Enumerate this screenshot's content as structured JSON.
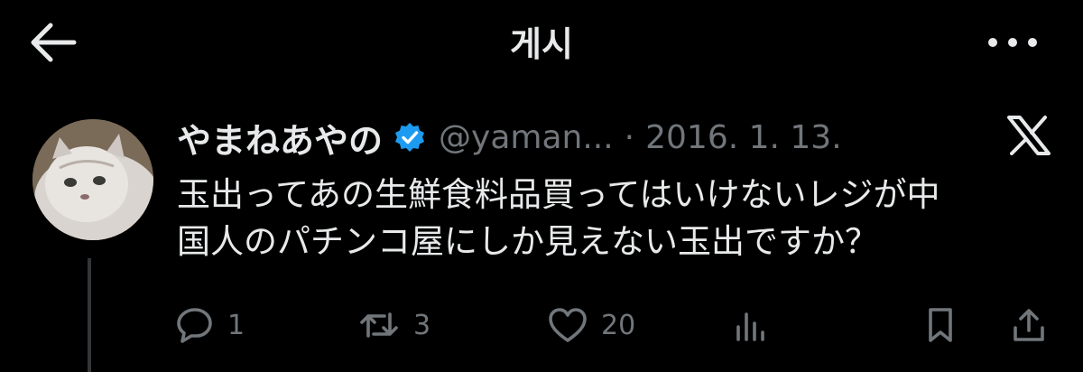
{
  "header": {
    "title": "게시",
    "back_icon": "arrow-left-icon",
    "more_icon": "more-horizontal-icon"
  },
  "tweet": {
    "display_name": "やまねあやの",
    "handle": "@yaman...",
    "separator": "·",
    "date": "2016. 1. 13.",
    "verified": true,
    "verified_color": "#1d9bf0",
    "text": "玉出ってあの生鮮食料品買ってはいけないレジが中\n国人のパチンコ屋にしか見えない玉出ですか？",
    "platform_icon": "x-logo-icon"
  },
  "actions": {
    "replies": "1",
    "reposts": "3",
    "likes": "20",
    "icons": [
      "reply-icon",
      "repost-icon",
      "like-icon",
      "views-icon",
      "bookmark-icon",
      "share-icon"
    ]
  },
  "colors": {
    "background": "#000000",
    "primary_text": "#e7e9ea",
    "secondary_text": "#71767b",
    "divider": "#333639"
  }
}
